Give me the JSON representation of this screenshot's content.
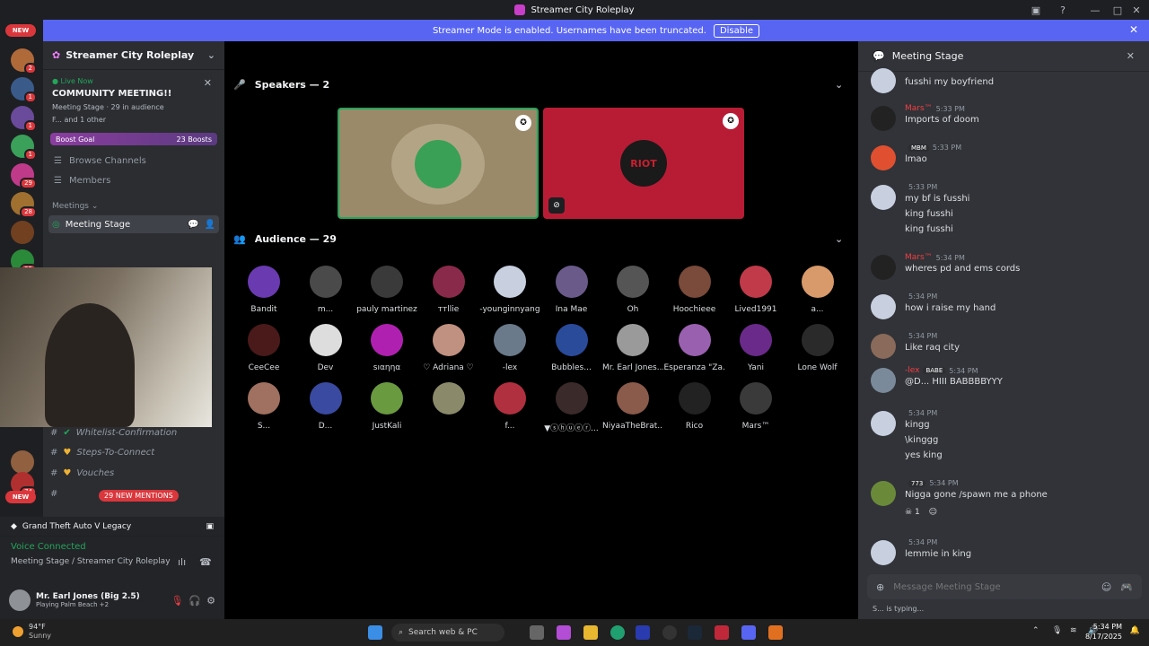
{
  "window": {
    "title": "Streamer City Roleplay"
  },
  "banner": {
    "text": "Streamer Mode is enabled. Usernames have been truncated.",
    "button": "Disable"
  },
  "servers": {
    "new_top": "NEW",
    "new_bottom": "NEW",
    "badges": [
      "2",
      "1",
      "1",
      "1",
      "29",
      "28",
      "22",
      "74"
    ]
  },
  "sidebar": {
    "server_name": "Streamer City Roleplay",
    "event": {
      "live": "Live Now",
      "title": "COMMUNITY MEETING!!",
      "meta": "Meeting Stage · 29 in audience",
      "others": "F... and 1 other"
    },
    "boost": {
      "label": "Boost Goal",
      "count": "23 Boosts"
    },
    "browse": "Browse Channels",
    "members": "Members",
    "category": "Meetings",
    "stage": "Meeting Stage",
    "channels": [
      "Whitelist-Confirmation",
      "Steps-To-Connect",
      "Vouches"
    ],
    "mentions": "29 NEW MENTIONS"
  },
  "voice": {
    "game": "Grand Theft Auto V Legacy",
    "connected": "Voice Connected",
    "location": "Meeting Stage / Streamer City Roleplay",
    "user": "Mr. Earl Jones (Big 2.5)",
    "status": "Playing Palm Beach +2"
  },
  "stage": {
    "speakers": "Speakers — 2",
    "audience": "Audience — 29",
    "riot_text": "RIOT",
    "audience_names": [
      "Bandit",
      "m...",
      "pauly martinez",
      "ттllie",
      "-younginnyang",
      "Ina Mae",
      "Oh",
      "Hoochieee",
      "Lived1991",
      "a...",
      "CeeCee",
      "Dev",
      "sıαηηα",
      "♡ Adriana ♡",
      "-lex",
      "Bubbles...",
      "Mr. Earl Jones...",
      "Esperanza \"Za...",
      "Yani",
      "Lone Wolf",
      "S...",
      "D...",
      "JustKali",
      "",
      "f...",
      "▼ⓢⓗⓤⓔⓡ...",
      "NiyaaTheBrat...",
      "Rico",
      "Mars™"
    ]
  },
  "chat": {
    "title": "Meeting Stage",
    "messages": [
      {
        "author": "",
        "time": "",
        "lines": [
          "fusshi my boyfriend"
        ]
      },
      {
        "author": "Mars™",
        "time": "5:33 PM",
        "lines": [
          "Imports of doom"
        ]
      },
      {
        "author": "",
        "tag": "MBM",
        "time": "5:33 PM",
        "lines": [
          "lmao"
        ]
      },
      {
        "author": "",
        "time": "5:33 PM",
        "lines": [
          "my bf is fusshi",
          "king fusshi",
          "king fusshi"
        ]
      },
      {
        "author": "Mars™",
        "time": "5:34 PM",
        "lines": [
          "wheres pd and ems cords"
        ]
      },
      {
        "author": "",
        "time": "5:34 PM",
        "lines": [
          "how i raise my hand"
        ]
      },
      {
        "author": "",
        "time": "5:34 PM",
        "lines": [
          "Like raq city"
        ]
      },
      {
        "author": "-lex",
        "tag": "BABE",
        "time": "5:34 PM",
        "lines": [
          "@D...  HIII BABBBBYYY"
        ]
      },
      {
        "author": "",
        "time": "5:34 PM",
        "lines": [
          "kingg",
          "\\kinggg",
          "yes  king"
        ]
      },
      {
        "author": "",
        "tag": "773",
        "time": "5:34 PM",
        "lines": [
          "Nigga gone /spawn me a phone"
        ],
        "reaction": "1"
      },
      {
        "author": "",
        "time": "5:34 PM",
        "lines": [
          "lemmie in king"
        ]
      }
    ],
    "placeholder": "Message Meeting Stage",
    "typing": "S... is typing..."
  },
  "taskbar": {
    "weather_temp": "94°F",
    "weather_desc": "Sunny",
    "search": "Search web & PC",
    "time": "5:34 PM",
    "date": "8/17/2025"
  }
}
